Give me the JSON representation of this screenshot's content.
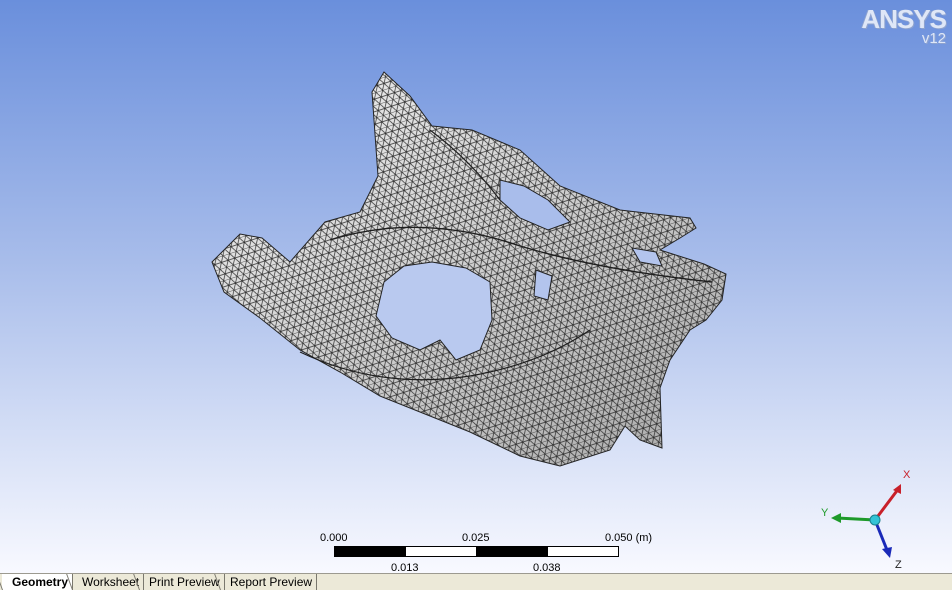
{
  "logo": {
    "brand": "ANSYS",
    "version": "v12"
  },
  "scale_bar": {
    "top_labels": [
      "0.000",
      "0.025",
      "0.050 (m)"
    ],
    "bottom_labels": [
      "0.013",
      "0.038"
    ]
  },
  "triad": {
    "x_label": "X",
    "y_label": "Y",
    "z_label": "Z",
    "x_color": "#c8202a",
    "y_color": "#1e9a2a",
    "z_color": "#1a2ab8"
  },
  "tabs": [
    {
      "label": "Geometry",
      "active": true
    },
    {
      "label": "Worksheet",
      "active": false
    },
    {
      "label": "Print Preview",
      "active": false
    },
    {
      "label": "Report Preview",
      "active": false
    }
  ]
}
